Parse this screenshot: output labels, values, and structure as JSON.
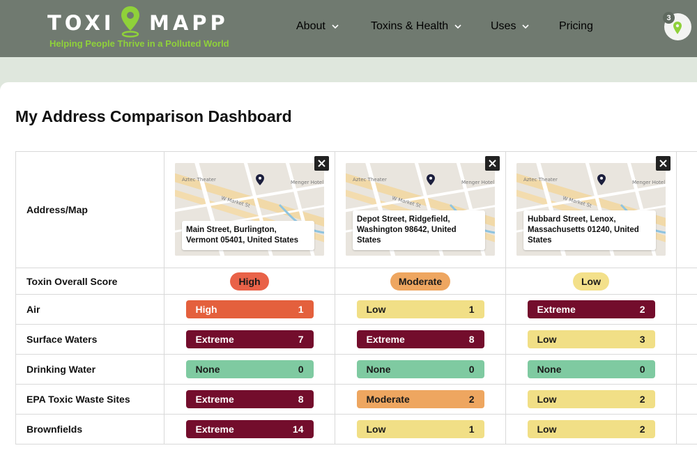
{
  "header": {
    "logo_left": "TOXI",
    "logo_right": "MAPP",
    "tagline": "Helping People Thrive in a Polluted World",
    "nav": [
      "About",
      "Toxins & Health",
      "Uses",
      "Pricing"
    ],
    "cart_count": "3"
  },
  "colors": {
    "brand_green": "#8fd13a",
    "header_bg": "#707a70",
    "extreme": "#730d2c",
    "high": "#e4603d",
    "moderate": "#eea660",
    "low": "#f1df86",
    "none": "#7fcaa1"
  },
  "icons": {
    "logo_pin": "map-pin-icon",
    "close": "close-icon",
    "nav_dropdown": "chevron-down-icon",
    "map_marker": "map-marker-icon"
  },
  "dashboard": {
    "title": "My Address Comparison Dashboard",
    "row_labels": {
      "address": "Address/Map",
      "score": "Toxin Overall Score",
      "metrics": [
        "Air",
        "Surface Waters",
        "Drinking Water",
        "EPA Toxic Waste Sites",
        "Brownfields"
      ]
    },
    "map_labels": {
      "aztec": "Aztec Theater",
      "menger": "Menger Hotel",
      "market": "W Market St"
    },
    "addresses": [
      {
        "address": "Main Street, Burlington, Vermont 05401, United States",
        "score": "High",
        "metrics": [
          {
            "level": "High",
            "count": "1"
          },
          {
            "level": "Extreme",
            "count": "7"
          },
          {
            "level": "None",
            "count": "0"
          },
          {
            "level": "Extreme",
            "count": "8"
          },
          {
            "level": "Extreme",
            "count": "14"
          }
        ]
      },
      {
        "address": "Depot Street, Ridgefield, Washington 98642, United States",
        "score": "Moderate",
        "metrics": [
          {
            "level": "Low",
            "count": "1"
          },
          {
            "level": "Extreme",
            "count": "8"
          },
          {
            "level": "None",
            "count": "0"
          },
          {
            "level": "Moderate",
            "count": "2"
          },
          {
            "level": "Low",
            "count": "1"
          }
        ]
      },
      {
        "address": "Hubbard Street, Lenox, Massachusetts 01240, United States",
        "score": "Low",
        "metrics": [
          {
            "level": "Extreme",
            "count": "2"
          },
          {
            "level": "Low",
            "count": "3"
          },
          {
            "level": "None",
            "count": "0"
          },
          {
            "level": "Low",
            "count": "2"
          },
          {
            "level": "Low",
            "count": "2"
          }
        ]
      }
    ]
  }
}
